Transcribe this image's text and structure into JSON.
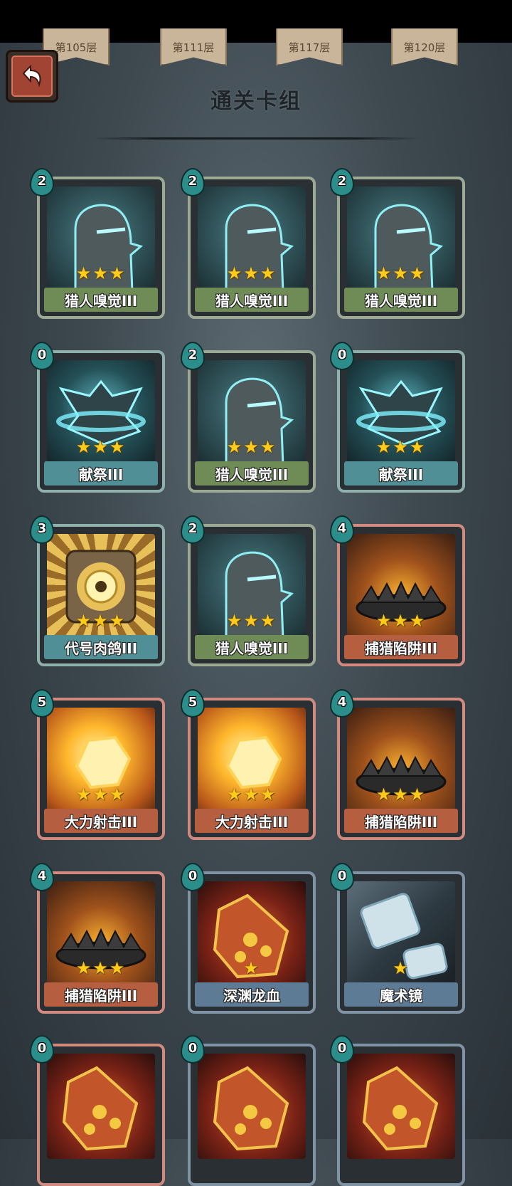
{
  "floor_banners": [
    "第105层",
    "第111层",
    "第117层",
    "第120层"
  ],
  "back_icon": "return-arrow-icon",
  "title": "通关卡组",
  "cards": [
    {
      "cost": "2",
      "name": "猎人嗅觉III",
      "stars": "★★★",
      "frame": "green",
      "art": "hunter"
    },
    {
      "cost": "2",
      "name": "猎人嗅觉III",
      "stars": "★★★",
      "frame": "green",
      "art": "hunter"
    },
    {
      "cost": "2",
      "name": "猎人嗅觉III",
      "stars": "★★★",
      "frame": "green",
      "art": "hunter"
    },
    {
      "cost": "0",
      "name": "献祭III",
      "stars": "★★★",
      "frame": "teal",
      "art": "sac"
    },
    {
      "cost": "2",
      "name": "猎人嗅觉III",
      "stars": "★★★",
      "frame": "green",
      "art": "hunter"
    },
    {
      "cost": "0",
      "name": "献祭III",
      "stars": "★★★",
      "frame": "teal",
      "art": "sac"
    },
    {
      "cost": "3",
      "name": "代号肉鸽III",
      "stars": "★★★",
      "frame": "teal",
      "art": "pigeon"
    },
    {
      "cost": "2",
      "name": "猎人嗅觉III",
      "stars": "★★★",
      "frame": "green",
      "art": "hunter"
    },
    {
      "cost": "4",
      "name": "捕猎陷阱III",
      "stars": "★★★",
      "frame": "red",
      "art": "trap"
    },
    {
      "cost": "5",
      "name": "大力射击III",
      "stars": "★★★",
      "frame": "red",
      "art": "power"
    },
    {
      "cost": "5",
      "name": "大力射击III",
      "stars": "★★★",
      "frame": "red",
      "art": "power"
    },
    {
      "cost": "4",
      "name": "捕猎陷阱III",
      "stars": "★★★",
      "frame": "red",
      "art": "trap"
    },
    {
      "cost": "4",
      "name": "捕猎陷阱III",
      "stars": "★★★",
      "frame": "red",
      "art": "trap"
    },
    {
      "cost": "0",
      "name": "深渊龙血",
      "stars": "★",
      "frame": "blue",
      "art": "blood"
    },
    {
      "cost": "0",
      "name": "魔术镜",
      "stars": "★",
      "frame": "blue",
      "art": "mirror"
    },
    {
      "cost": "0",
      "name": "",
      "stars": "",
      "frame": "red",
      "art": "blood"
    },
    {
      "cost": "0",
      "name": "",
      "stars": "",
      "frame": "blue",
      "art": "blood"
    },
    {
      "cost": "0",
      "name": "",
      "stars": "",
      "frame": "blue",
      "art": "blood"
    }
  ]
}
